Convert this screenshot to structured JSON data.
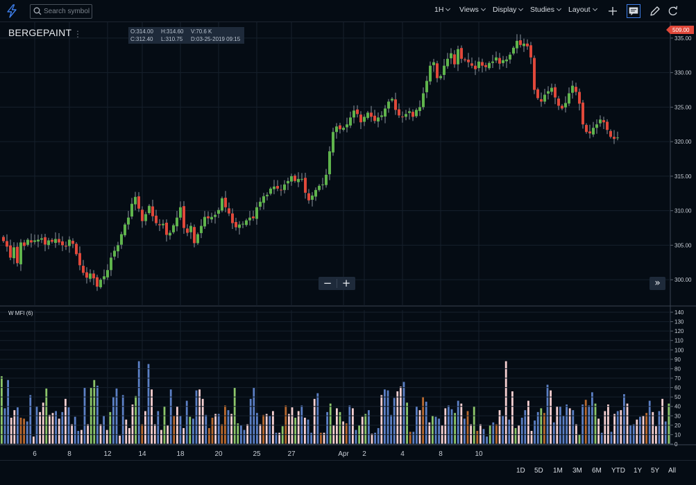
{
  "toolbar": {
    "search_placeholder": "Search symbol",
    "interval_label": "1H",
    "views_label": "Views",
    "display_label": "Display",
    "studies_label": "Studies",
    "layout_label": "Layout"
  },
  "symbol": "BERGEPAINT",
  "ohlc": {
    "open": "O:314.00",
    "high": "H:314.60",
    "volume": "V:70.6 K",
    "close": "C:312.40",
    "low": "L:310.75",
    "date": "D:03-25-2019 09:15"
  },
  "zoom": {
    "out_label": "−",
    "in_label": "+"
  },
  "scroll_right_label": "»",
  "mfi_label": "W MFI (6)",
  "ranges": [
    "1D",
    "5D",
    "1M",
    "3M",
    "6M",
    "YTD",
    "1Y",
    "5Y",
    "All"
  ],
  "colors": {
    "background": "#050c14",
    "grid": "#16202c",
    "up": "#5fb44c",
    "down": "#e0483a",
    "accent": "#3d7de8",
    "mfi_blue": "#5b7fc4",
    "mfi_pink": "#f5cfd0",
    "mfi_green": "#8cc56a",
    "mfi_orange": "#b8692f"
  },
  "chart_data": [
    {
      "type": "candlestick",
      "title": "BERGEPAINT",
      "last_price": 320.5,
      "last_price_label": "509.00",
      "ylim": [
        296.2,
        337.3
      ],
      "y_ticks": [
        "335.00",
        "330.00",
        "325.00",
        "320.00",
        "315.00",
        "310.00",
        "305.00",
        "300.00"
      ],
      "y_tick_values": [
        335,
        330,
        325,
        320,
        315,
        310,
        305,
        300
      ],
      "x_tick_labels": [
        "6",
        "8",
        "12",
        "14",
        "18",
        "20",
        "25",
        "27",
        "Apr",
        "2",
        "4",
        "8",
        "10"
      ],
      "x_tick_bar_index": [
        9,
        19,
        30,
        40,
        51,
        62,
        73,
        83,
        98,
        104,
        115,
        126,
        137
      ],
      "closes": [
        305.6,
        304.8,
        303.2,
        304.7,
        302.4,
        305.4,
        304.9,
        305.8,
        305.4,
        305.7,
        305.8,
        306.0,
        305.1,
        305.7,
        305.5,
        305.9,
        305.4,
        305.0,
        304.8,
        305.8,
        305.2,
        303.7,
        302.1,
        301.0,
        300.3,
        300.9,
        300.2,
        299.0,
        300.0,
        300.5,
        301.4,
        303.2,
        304.2,
        305.0,
        306.6,
        308.0,
        309.0,
        311.0,
        312.0,
        310.3,
        308.5,
        309.5,
        310.7,
        309.2,
        308.2,
        307.9,
        308.1,
        306.5,
        306.8,
        307.9,
        309.0,
        310.5,
        307.5,
        306.8,
        307.8,
        305.3,
        306.6,
        307.8,
        309.1,
        308.9,
        309.1,
        309.4,
        310.1,
        311.8,
        310.5,
        309.6,
        308.2,
        307.6,
        308.0,
        308.1,
        308.6,
        309.0,
        308.9,
        310.5,
        311.3,
        312.1,
        312.3,
        313.2,
        313.5,
        313.2,
        313.0,
        313.8,
        314.3,
        315.0,
        314.3,
        314.6,
        314.6,
        312.6,
        311.5,
        312.2,
        313.0,
        313.6,
        313.8,
        315.2,
        318.6,
        321.4,
        322.2,
        321.8,
        322.0,
        322.5,
        323.5,
        324.5,
        324.0,
        322.8,
        323.6,
        324.2,
        323.6,
        323.0,
        323.5,
        323.8,
        324.8,
        325.8,
        326.2,
        324.6,
        323.8,
        323.6,
        324.0,
        324.4,
        323.6,
        324.6,
        325.0,
        327.0,
        328.8,
        331.0,
        331.5,
        329.2,
        329.5,
        331.0,
        332.0,
        332.8,
        331.2,
        333.4,
        332.0,
        331.8,
        331.5,
        331.0,
        330.5,
        331.6,
        331.0,
        330.8,
        331.4,
        331.6,
        332.2,
        331.3,
        331.8,
        331.9,
        332.6,
        333.6,
        334.6,
        334.0,
        334.2,
        333.8,
        332.2,
        327.5,
        326.3,
        325.8,
        326.8,
        327.3,
        327.8,
        326.4,
        325.2,
        324.8,
        325.6,
        327.0,
        328.1,
        327.2,
        325.5,
        322.5,
        321.4,
        321.2,
        322.0,
        322.5,
        323.2,
        322.8,
        321.7,
        320.7,
        320.4,
        320.6
      ]
    },
    {
      "type": "bar",
      "title": "W MFI (6)",
      "ylim": [
        0,
        140
      ],
      "y_ticks": [
        "140",
        "130",
        "120",
        "110",
        "100",
        "90",
        "80",
        "70",
        "60",
        "50",
        "40",
        "30",
        "20",
        "10",
        "0"
      ],
      "values": [
        72,
        38,
        68,
        28,
        36,
        39,
        28,
        27,
        24,
        52,
        8,
        40,
        34,
        44,
        59,
        31,
        33,
        35,
        27,
        34,
        48,
        39,
        21,
        29,
        14,
        15,
        60,
        21,
        60,
        68,
        62,
        21,
        30,
        15,
        34,
        50,
        59,
        9,
        52,
        26,
        17,
        42,
        51,
        88,
        21,
        35,
        85,
        58,
        21,
        35,
        15,
        40,
        20,
        58,
        30,
        40,
        30,
        17,
        46,
        29,
        27,
        57,
        58,
        48,
        31,
        17,
        28,
        32,
        32,
        21,
        41,
        36,
        32,
        60,
        22,
        20,
        15,
        21,
        48,
        60,
        33,
        21,
        31,
        32,
        30,
        35,
        12,
        12,
        19,
        41,
        32,
        39,
        28,
        35,
        41,
        28,
        26,
        12,
        48,
        54,
        12,
        12,
        34,
        43,
        20,
        38,
        34,
        24,
        22,
        41,
        38,
        15,
        20,
        29,
        32,
        36,
        11,
        12,
        17,
        52,
        58,
        57,
        31,
        49,
        56,
        61,
        66,
        44,
        13,
        13,
        40,
        36,
        50,
        45,
        23,
        30,
        29,
        27,
        20,
        38,
        41,
        37,
        33,
        46,
        43,
        27,
        35,
        21,
        40,
        14,
        21,
        16,
        8,
        20,
        23,
        21,
        36,
        30,
        88,
        26,
        56,
        17,
        20,
        28,
        36,
        46,
        14,
        25,
        34,
        38,
        33,
        63,
        57,
        23,
        40,
        40,
        30,
        42,
        38,
        36,
        21,
        10,
        42,
        47,
        41,
        55,
        43,
        27,
        12,
        35,
        42,
        13,
        32,
        35,
        36,
        53,
        43,
        20,
        21,
        26,
        29,
        30,
        33,
        46,
        34,
        19,
        35,
        48,
        24,
        43,
        40,
        47,
        45,
        41,
        35
      ],
      "colors_seq": [
        "g",
        "b",
        "b",
        "p",
        "p",
        "b",
        "o",
        "o",
        "b",
        "b",
        "p",
        "b",
        "p",
        "p",
        "g",
        "p",
        "p",
        "b",
        "p",
        "b",
        "p",
        "b",
        "p",
        "b",
        "b",
        "p",
        "b",
        "p",
        "g",
        "g",
        "b",
        "p",
        "b",
        "p",
        "g",
        "b",
        "b",
        "p",
        "b",
        "p",
        "p",
        "p",
        "g",
        "b",
        "o",
        "p",
        "b",
        "p",
        "p",
        "b",
        "p",
        "g",
        "p",
        "b",
        "o",
        "p",
        "b",
        "p",
        "b",
        "g",
        "b",
        "b",
        "p",
        "p",
        "b",
        "o",
        "o",
        "p",
        "b",
        "o",
        "o",
        "b",
        "p",
        "g",
        "g",
        "b",
        "b",
        "p",
        "b",
        "b",
        "b",
        "p",
        "o",
        "p",
        "b",
        "p",
        "b",
        "p",
        "g",
        "o",
        "p",
        "p",
        "g",
        "p",
        "b",
        "p",
        "b",
        "b",
        "p",
        "b",
        "o",
        "p",
        "b",
        "g",
        "p",
        "p",
        "g",
        "p",
        "o",
        "b",
        "p",
        "b",
        "g",
        "p",
        "g",
        "b",
        "p",
        "b",
        "b",
        "p",
        "b",
        "b",
        "b",
        "b",
        "p",
        "p",
        "b",
        "g",
        "o",
        "b",
        "b",
        "p",
        "o",
        "b",
        "p",
        "g",
        "b",
        "b",
        "p",
        "p",
        "b",
        "b",
        "g",
        "b",
        "p",
        "b",
        "o",
        "p",
        "g",
        "o",
        "p",
        "b",
        "b",
        "g",
        "b",
        "o",
        "p",
        "b",
        "p",
        "b",
        "p",
        "g",
        "p",
        "b",
        "b",
        "p",
        "p",
        "b",
        "b",
        "g",
        "o",
        "b",
        "p",
        "b",
        "p",
        "b",
        "b",
        "b",
        "p",
        "b",
        "p",
        "g",
        "b",
        "o",
        "b",
        "b",
        "g",
        "p",
        "b",
        "p",
        "p",
        "b",
        "p",
        "b",
        "p",
        "b",
        "p",
        "b",
        "b",
        "p",
        "b",
        "p",
        "o",
        "b",
        "p",
        "p",
        "b",
        "p",
        "b",
        "g",
        "p",
        "b",
        "p",
        "g",
        "b"
      ]
    }
  ]
}
